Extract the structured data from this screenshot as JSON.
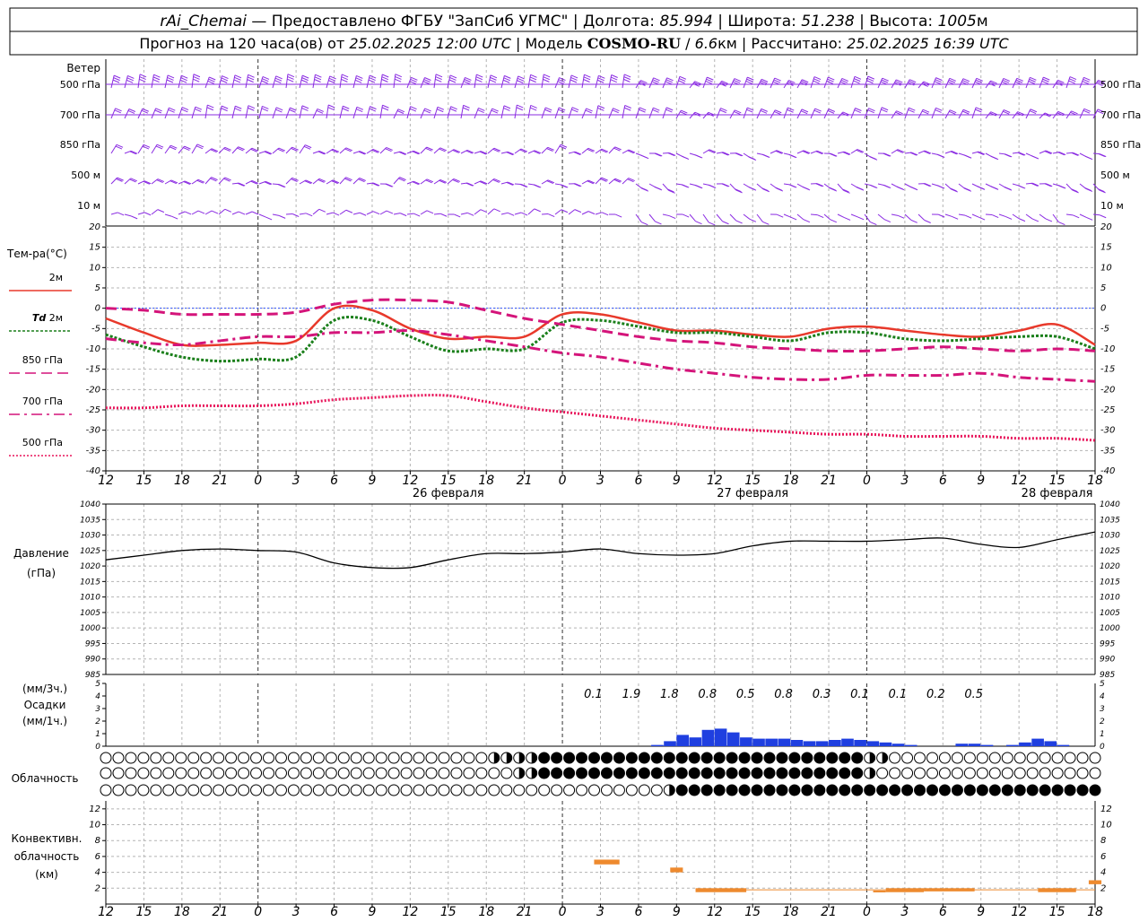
{
  "header": {
    "line1": [
      {
        "t": "rAi_Chemai",
        "style": "it"
      },
      {
        "t": " — Предоставлено ФГБУ \"ЗапСиб УГМС\" | Долгота: ",
        "style": ""
      },
      {
        "t": "85.994",
        "style": "it"
      },
      {
        "t": " | Широта: ",
        "style": ""
      },
      {
        "t": "51.238",
        "style": "it"
      },
      {
        "t": " | Высота: ",
        "style": ""
      },
      {
        "t": "1005",
        "style": "it"
      },
      {
        "t": "м",
        "style": ""
      }
    ],
    "line2": [
      {
        "t": "Прогноз на 120 часа(ов) от ",
        "style": ""
      },
      {
        "t": "25.02.2025 12:00 UTC",
        "style": "it"
      },
      {
        "t": " | Модель ",
        "style": ""
      },
      {
        "t": "COSMO-RU",
        "style": "bold"
      },
      {
        "t": " / ",
        "style": ""
      },
      {
        "t": "6.6",
        "style": "it"
      },
      {
        "t": "км | Рассчитано: ",
        "style": ""
      },
      {
        "t": "25.02.2025 16:39 UTC",
        "style": "it"
      }
    ]
  },
  "time_axis": {
    "hour_labels": [
      "12",
      "15",
      "18",
      "21",
      "0",
      "3",
      "6",
      "9",
      "12",
      "15",
      "18",
      "21",
      "0",
      "3",
      "6",
      "9",
      "12",
      "15",
      "18",
      "21",
      "0",
      "3",
      "6",
      "9",
      "12",
      "15",
      "18"
    ],
    "day_labels": [
      "26 февраля",
      "27 февраля",
      "28 февраля"
    ],
    "day_label_hours": [
      27,
      51,
      75
    ]
  },
  "wind_panel": {
    "title": "Ветер",
    "levels": [
      "500 гПа",
      "700 гПа",
      "850 гПа",
      "500 м",
      "10 м"
    ],
    "color": "#8a2be2"
  },
  "temp_panel": {
    "title": "Тем-ра(°C)",
    "yticks": [
      20,
      15,
      10,
      5,
      0,
      -5,
      -10,
      -15,
      -20,
      -25,
      -30,
      -35,
      -40
    ],
    "legend": [
      {
        "label": "2м",
        "color": "#e8392b",
        "dash": "solid"
      },
      {
        "label": "Td 2м",
        "color": "#1a7f1a",
        "dash": "dotted"
      },
      {
        "label": "850 гПа",
        "color": "#d4147a",
        "dash": "dashed"
      },
      {
        "label": "700 гПа",
        "color": "#d4147a",
        "dash": "dashdot"
      },
      {
        "label": "500 гПа",
        "color": "#e8145a",
        "dash": "dots"
      }
    ]
  },
  "pressure_panel": {
    "title": "Давление",
    "unit": "(гПа)",
    "yticks": [
      1040,
      1035,
      1030,
      1025,
      1020,
      1015,
      1010,
      1005,
      1000,
      995,
      990,
      985
    ]
  },
  "precip_panel": {
    "title1": "(мм/3ч.)",
    "title2": "Осадки",
    "title3": "(мм/1ч.)",
    "yticks": [
      5,
      4,
      3,
      2,
      1,
      0
    ],
    "sums": [
      "0.1",
      "1.9",
      "1.8",
      "0.8",
      "0.5",
      "0.8",
      "0.3",
      "0.1",
      "0.1",
      "0.2",
      "0.5"
    ],
    "sum_hours": [
      39,
      42,
      45,
      48,
      51,
      54,
      57,
      60,
      63,
      66,
      69
    ]
  },
  "cloud_panel": {
    "title": "Облачность"
  },
  "conv_panel": {
    "title1": "Конвективн.",
    "title2": "облачность",
    "title3": "(км)",
    "yticks": [
      12,
      10,
      8,
      6,
      4,
      2
    ]
  },
  "colors": {
    "grid": "#b4b4b4",
    "frame": "#000000",
    "precip": "#1f3fe0",
    "conv": "#ee8a2e",
    "zero_line": "#3355ff"
  },
  "chart_data": [
    {
      "type": "line",
      "title": "Тем-ра(°C)",
      "x_unit": "часы от 25.02.2025 12:00 UTC",
      "x": [
        0,
        3,
        6,
        9,
        12,
        15,
        18,
        21,
        24,
        27,
        30,
        33,
        36,
        39,
        42,
        45,
        48,
        51,
        54,
        57,
        60,
        63,
        66,
        69,
        72,
        75,
        78
      ],
      "ylim": [
        -40,
        20
      ],
      "series": [
        {
          "name": "2м",
          "values": [
            -2.5,
            -6,
            -9,
            -9,
            -8.5,
            -8,
            0,
            -0.5,
            -5,
            -7.5,
            -7,
            -7,
            -1.5,
            -1.5,
            -3.5,
            -5.5,
            -5.5,
            -6.5,
            -7,
            -5,
            -4.5,
            -5.5,
            -6.5,
            -7,
            -5.5,
            -4,
            -9
          ]
        },
        {
          "name": "Td 2м",
          "values": [
            -6.5,
            -9.5,
            -12,
            -13,
            -12.5,
            -12,
            -3,
            -3,
            -7,
            -10.5,
            -10,
            -10,
            -3.5,
            -3,
            -4.5,
            -6,
            -6,
            -7,
            -8,
            -6,
            -6,
            -7.5,
            -8,
            -7.5,
            -7,
            -7,
            -10
          ]
        },
        {
          "name": "850 гПа",
          "values": [
            0,
            -0.5,
            -1.5,
            -1.5,
            -1.5,
            -1,
            1,
            2,
            2,
            1.5,
            -0.5,
            -2.5,
            -4,
            -5.5,
            -7,
            -8,
            -8.5,
            -9.5,
            -10,
            -10.5,
            -10.5,
            -10,
            -9.5,
            -10,
            -10.5,
            -10,
            -10.5
          ]
        },
        {
          "name": "700 гПа",
          "values": [
            -7.5,
            -8.5,
            -9,
            -8,
            -7,
            -7,
            -6,
            -6,
            -5.5,
            -6.5,
            -8,
            -9.5,
            -11,
            -12,
            -13.5,
            -15,
            -16,
            -17,
            -17.5,
            -17.5,
            -16.5,
            -16.5,
            -16.5,
            -16,
            -17,
            -17.5,
            -18
          ]
        },
        {
          "name": "500 гПа",
          "values": [
            -24.5,
            -24.5,
            -24,
            -24,
            -24,
            -23.5,
            -22.5,
            -22,
            -21.5,
            -21.5,
            -23,
            -24.5,
            -25.5,
            -26.5,
            -27.5,
            -28.5,
            -29.5,
            -30,
            -30.5,
            -31,
            -31,
            -31.5,
            -31.5,
            -31.5,
            -32,
            -32,
            -32.5
          ]
        }
      ]
    },
    {
      "type": "line",
      "title": "Давление",
      "x_unit": "часы от 25.02.2025 12:00 UTC",
      "x": [
        0,
        3,
        6,
        9,
        12,
        15,
        18,
        21,
        24,
        27,
        30,
        33,
        36,
        39,
        42,
        45,
        48,
        51,
        54,
        57,
        60,
        63,
        66,
        69,
        72,
        75,
        78
      ],
      "ylim": [
        985,
        1040
      ],
      "series": [
        {
          "name": "Давление",
          "values": [
            1022,
            1023.5,
            1025,
            1025.5,
            1025,
            1024.5,
            1021,
            1019.5,
            1019.5,
            1022,
            1024,
            1024,
            1024.5,
            1025.5,
            1024,
            1023.5,
            1024,
            1026.5,
            1028,
            1028,
            1028,
            1028.5,
            1029,
            1027,
            1026,
            1028.5,
            1031
          ]
        }
      ]
    },
    {
      "type": "bar",
      "title": "Осадки",
      "x_unit": "часы от 25.02.2025 12:00 UTC",
      "x": [
        44,
        45,
        46,
        47,
        48,
        49,
        50,
        51,
        52,
        53,
        54,
        55,
        56,
        57,
        58,
        59,
        60,
        61,
        62,
        63,
        64,
        65,
        66,
        67,
        68,
        69,
        70,
        71,
        72,
        73,
        74,
        75,
        76,
        77,
        78
      ],
      "ylim": [
        0,
        5
      ],
      "values": [
        0.1,
        0.4,
        0.9,
        0.7,
        1.3,
        1.4,
        1.1,
        0.7,
        0.6,
        0.6,
        0.6,
        0.5,
        0.4,
        0.4,
        0.5,
        0.6,
        0.5,
        0.4,
        0.3,
        0.2,
        0.1,
        0.0,
        0.0,
        0.0,
        0.2,
        0.2,
        0.1,
        0.0,
        0.1,
        0.3,
        0.6,
        0.4,
        0.1,
        0.0,
        0.0
      ]
    },
    {
      "type": "bar",
      "title": "Конвективн. облачность (км)",
      "x_unit": "часы от 25.02.2025 12:00 UTC",
      "ylim": [
        0,
        13
      ],
      "segments": [
        {
          "start": 38.5,
          "end": 40.5,
          "base": 5,
          "top": 5.6
        },
        {
          "start": 44.5,
          "end": 45.5,
          "base": 4,
          "top": 4.6
        },
        {
          "start": 46.5,
          "end": 50.5,
          "base": 1.5,
          "top": 2.0
        },
        {
          "start": 60.5,
          "end": 61.5,
          "base": 1.5,
          "top": 1.7
        },
        {
          "start": 61.5,
          "end": 64.5,
          "base": 1.5,
          "top": 2.0
        },
        {
          "start": 64.5,
          "end": 68.5,
          "base": 1.6,
          "top": 2.0
        },
        {
          "start": 73.5,
          "end": 76.5,
          "base": 1.5,
          "top": 2.0
        },
        {
          "start": 77.5,
          "end": 78.5,
          "base": 2.5,
          "top": 3.0
        }
      ]
    }
  ]
}
